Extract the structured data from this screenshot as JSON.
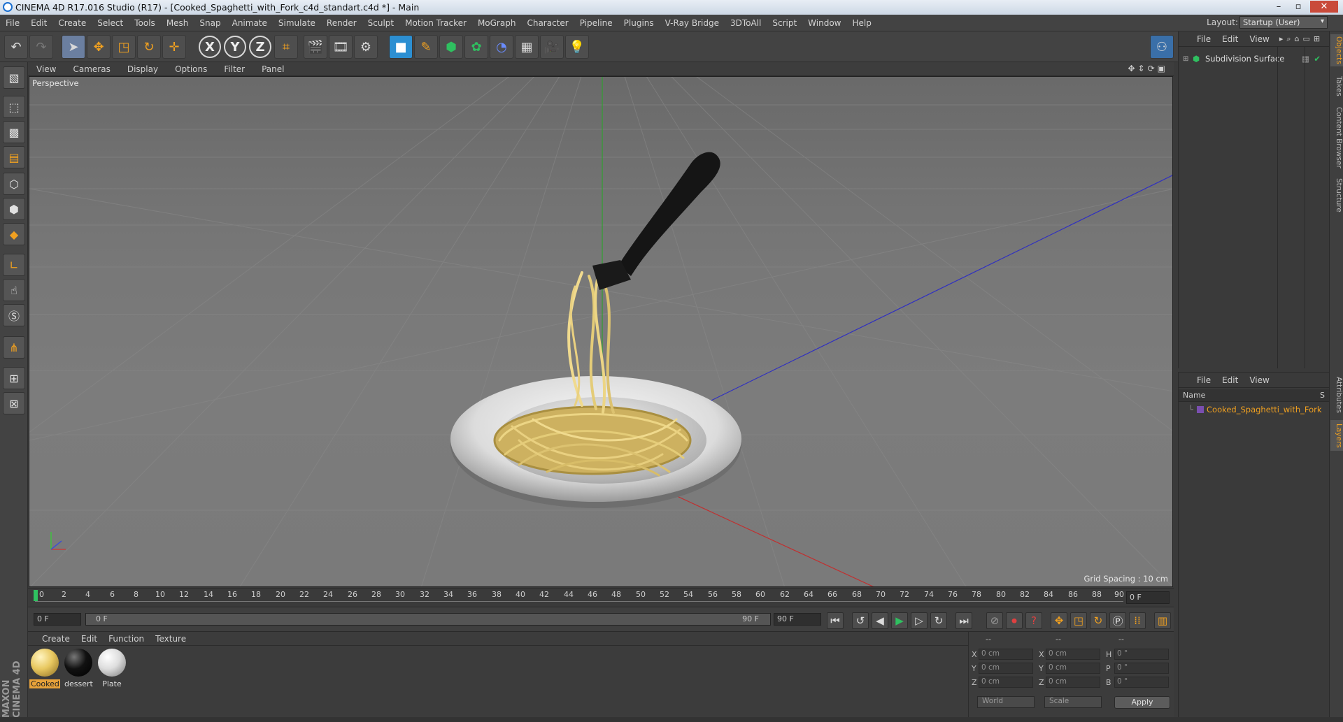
{
  "window": {
    "title": "CINEMA 4D R17.016 Studio (R17) - [Cooked_Spaghetti_with_Fork_c4d_standart.c4d *] - Main"
  },
  "menubar": {
    "items": [
      "File",
      "Edit",
      "Create",
      "Select",
      "Tools",
      "Mesh",
      "Snap",
      "Animate",
      "Simulate",
      "Render",
      "Sculpt",
      "Motion Tracker",
      "MoGraph",
      "Character",
      "Pipeline",
      "Plugins",
      "V-Ray Bridge",
      "3DToAll",
      "Script",
      "Window",
      "Help"
    ],
    "layout_label": "Layout:",
    "layout_value": "Startup (User)"
  },
  "toolbar": {
    "axis_x": "X",
    "axis_y": "Y",
    "axis_z": "Z"
  },
  "viewport": {
    "menu": [
      "View",
      "Cameras",
      "Display",
      "Options",
      "Filter",
      "Panel"
    ],
    "label": "Perspective",
    "grid_spacing": "Grid Spacing : 10 cm"
  },
  "timeline": {
    "ticks": [
      "0",
      "2",
      "4",
      "6",
      "8",
      "10",
      "12",
      "14",
      "16",
      "18",
      "20",
      "22",
      "24",
      "26",
      "28",
      "30",
      "32",
      "34",
      "36",
      "38",
      "40",
      "42",
      "44",
      "46",
      "48",
      "50",
      "52",
      "54",
      "56",
      "58",
      "60",
      "62",
      "64",
      "66",
      "68",
      "70",
      "72",
      "74",
      "76",
      "78",
      "80",
      "82",
      "84",
      "86",
      "88",
      "90"
    ],
    "current_frame": "0 F"
  },
  "playback": {
    "start_field": "0 F",
    "range_start": "0 F",
    "range_end": "90 F",
    "end_field": "90 F"
  },
  "materials": {
    "menu": [
      "Create",
      "Edit",
      "Function",
      "Texture"
    ],
    "items": [
      {
        "label": "Cooked",
        "color": "#e8c860",
        "selected": true
      },
      {
        "label": "dessert",
        "color": "#111111",
        "selected": false
      },
      {
        "label": "Plate",
        "color": "#dddddd",
        "selected": false
      }
    ]
  },
  "coordinates": {
    "headers": [
      "--",
      "--",
      "--"
    ],
    "rows": [
      {
        "a": "X",
        "av": "0 cm",
        "b": "X",
        "bv": "0 cm",
        "c": "H",
        "cv": "0 °"
      },
      {
        "a": "Y",
        "av": "0 cm",
        "b": "Y",
        "bv": "0 cm",
        "c": "P",
        "cv": "0 °"
      },
      {
        "a": "Z",
        "av": "0 cm",
        "b": "Z",
        "bv": "0 cm",
        "c": "B",
        "cv": "0 °"
      }
    ],
    "mode": "World",
    "scale": "Scale",
    "apply": "Apply"
  },
  "object_manager": {
    "menu": [
      "File",
      "Edit",
      "View"
    ],
    "objects": [
      "Subdivision Surface"
    ]
  },
  "layer_manager": {
    "menu": [
      "File",
      "Edit",
      "View"
    ],
    "col_name": "Name",
    "col_s": "S",
    "layers": [
      "Cooked_Spaghetti_with_Fork"
    ]
  },
  "side_tabs": [
    "Objects",
    "Takes",
    "Content Browser",
    "Structure",
    "Attributes",
    "Layers"
  ],
  "colors": {
    "accent": "#f0a020",
    "panel": "#3a3a3a",
    "viewport_bg": "#777777"
  }
}
